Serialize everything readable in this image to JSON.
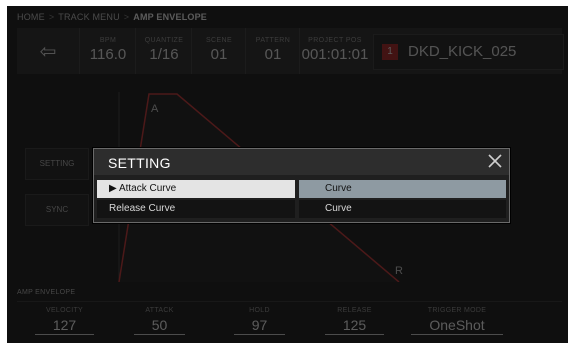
{
  "breadcrumb": {
    "items": [
      "HOME",
      "TRACK MENU",
      "AMP ENVELOPE"
    ]
  },
  "topbar": {
    "back_glyph": "⇦",
    "params": [
      {
        "label": "BPM",
        "value": "116.0"
      },
      {
        "label": "QUANTIZE",
        "value": "1/16"
      },
      {
        "label": "SCENE",
        "value": "01"
      },
      {
        "label": "PATTERN",
        "value": "01"
      },
      {
        "label": "PROJECT POS",
        "value": "001:01:01"
      }
    ],
    "track_number": "1",
    "track_name": "DKD_KICK_025"
  },
  "graph": {
    "attack_marker": "A",
    "release_marker": "R"
  },
  "side_buttons": {
    "setting": "SETTING",
    "sync": "SYNC"
  },
  "bottom": {
    "section_label": "AMP ENVELOPE",
    "params": [
      {
        "label": "VELOCITY",
        "value": "127"
      },
      {
        "label": "ATTACK",
        "value": "50"
      },
      {
        "label": "HOLD",
        "value": "97"
      },
      {
        "label": "RELEASE",
        "value": "125"
      },
      {
        "label": "TRIGGER MODE",
        "value": "OneShot"
      }
    ]
  },
  "dialog": {
    "title": "SETTING",
    "rows": [
      {
        "name": "Attack Curve",
        "value": "Curve",
        "selected": true,
        "marker": "▶"
      },
      {
        "name": "Release Curve",
        "value": "Curve",
        "selected": false,
        "marker": ""
      }
    ]
  },
  "colors": {
    "accent_red": "#b01d1d",
    "selection_light": "#e4e4e4",
    "selection_value": "#8e9aa2"
  },
  "icons": {
    "back": "back-arrow-icon",
    "close": "close-icon",
    "marker": "play-marker-icon"
  }
}
